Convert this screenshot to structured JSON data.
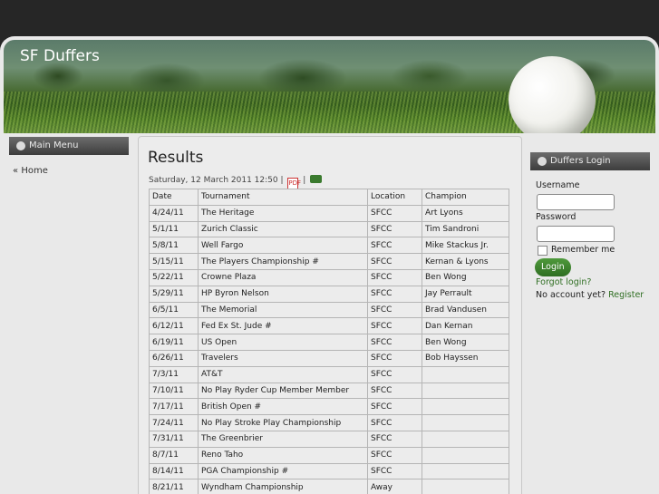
{
  "site": {
    "title": "SF Duffers"
  },
  "main_menu": {
    "heading": "Main Menu",
    "items": [
      {
        "label": "Home",
        "icon": "chevron-left-double-icon"
      }
    ]
  },
  "article": {
    "title": "Results",
    "date": "Saturday, 12 March 2011 12:50",
    "separator": "|",
    "pdf_icon": "pdf-icon",
    "print_icon": "print-icon"
  },
  "table": {
    "headers": [
      "Date",
      "Tournament",
      "Location",
      "Champion"
    ],
    "rows": [
      [
        "4/24/11",
        "The Heritage",
        "SFCC",
        "Art Lyons"
      ],
      [
        "5/1/11",
        "Zurich Classic",
        "SFCC",
        "Tim Sandroni"
      ],
      [
        "5/8/11",
        "Well Fargo",
        "SFCC",
        "Mike Stackus Jr."
      ],
      [
        "5/15/11",
        "The Players Championship #",
        "SFCC",
        "Kernan & Lyons"
      ],
      [
        "5/22/11",
        "Crowne Plaza",
        "SFCC",
        "Ben Wong"
      ],
      [
        "5/29/11",
        "HP Byron Nelson",
        "SFCC",
        "Jay Perrault"
      ],
      [
        "6/5/11",
        "The Memorial",
        "SFCC",
        "Brad Vandusen"
      ],
      [
        "6/12/11",
        "Fed Ex St. Jude #",
        "SFCC",
        "Dan Kernan"
      ],
      [
        "6/19/11",
        "US Open",
        "SFCC",
        "Ben Wong"
      ],
      [
        "6/26/11",
        "Travelers",
        "SFCC",
        "Bob Hayssen"
      ],
      [
        "7/3/11",
        "AT&T",
        "SFCC",
        ""
      ],
      [
        "7/10/11",
        "No Play Ryder Cup Member Member",
        "SFCC",
        ""
      ],
      [
        "7/17/11",
        "British Open #",
        "SFCC",
        ""
      ],
      [
        "7/24/11",
        "No Play Stroke Play Championship",
        "SFCC",
        ""
      ],
      [
        "7/31/11",
        "The Greenbrier",
        "SFCC",
        ""
      ],
      [
        "8/7/11",
        "Reno Taho",
        "SFCC",
        ""
      ],
      [
        "8/14/11",
        "PGA Championship #",
        "SFCC",
        ""
      ],
      [
        "8/21/11",
        "Wyndham Championship",
        "Away",
        ""
      ]
    ]
  },
  "login": {
    "heading": "Duffers Login",
    "username_label": "Username",
    "username_value": "",
    "password_label": "Password",
    "password_value": "",
    "remember_label": "Remember me",
    "remember_checked": false,
    "login_button": "Login",
    "forgot_link": "Forgot login?",
    "no_account_text": "No account yet?",
    "register_link": "Register"
  },
  "colors": {
    "background": "#262626",
    "page": "#e9e9e9",
    "module_header": "#4a4a4a",
    "login_button": "#3f8530",
    "link_dark": "#333333",
    "link_green": "#2f6e22"
  }
}
